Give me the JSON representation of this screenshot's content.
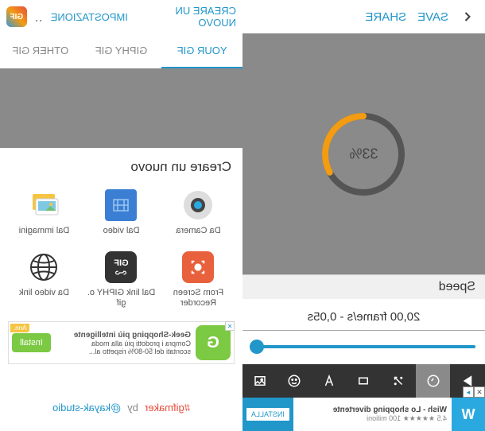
{
  "left": {
    "save": "SAVE",
    "share": "SHARE",
    "progress_pct": "33%",
    "speed_label": "Speed",
    "speed_value": "20,00 frame/s - 0,05s",
    "slider_fill_pct": 98,
    "ad": {
      "badge": "W",
      "title": "Wish - Lo shopping divertente",
      "rating": "4.5 ★★★★★ 100 milioni",
      "install": "INSTALLA"
    }
  },
  "right": {
    "nav1": "CREARE UN NUOVO",
    "nav2": "IMPOSTAZIONE",
    "logo": "GIF",
    "tabs": {
      "your": "YOUR GIF",
      "giphy": "GIPHY GIF",
      "other": "OTHER GIF"
    },
    "sheet_title": "Creare un nuovo",
    "items": {
      "camera": "Da Camera",
      "video": "Dal video",
      "images": "Dal immagini",
      "screen": "From Screen Recorder",
      "giphy_link": "Dal link GIPHY o. gif",
      "video_link": "Da video link"
    },
    "ad": {
      "ann": "Ann.",
      "title": "Geek-Shopping più intelligente",
      "line2": "Compra i prodotti più alla moda",
      "line3": "scontati del 50-80% rispetto al...",
      "install": "Install"
    },
    "footer": {
      "by": "by",
      "handle": "@kayak-studio",
      "hash": "#gifmaker"
    }
  }
}
